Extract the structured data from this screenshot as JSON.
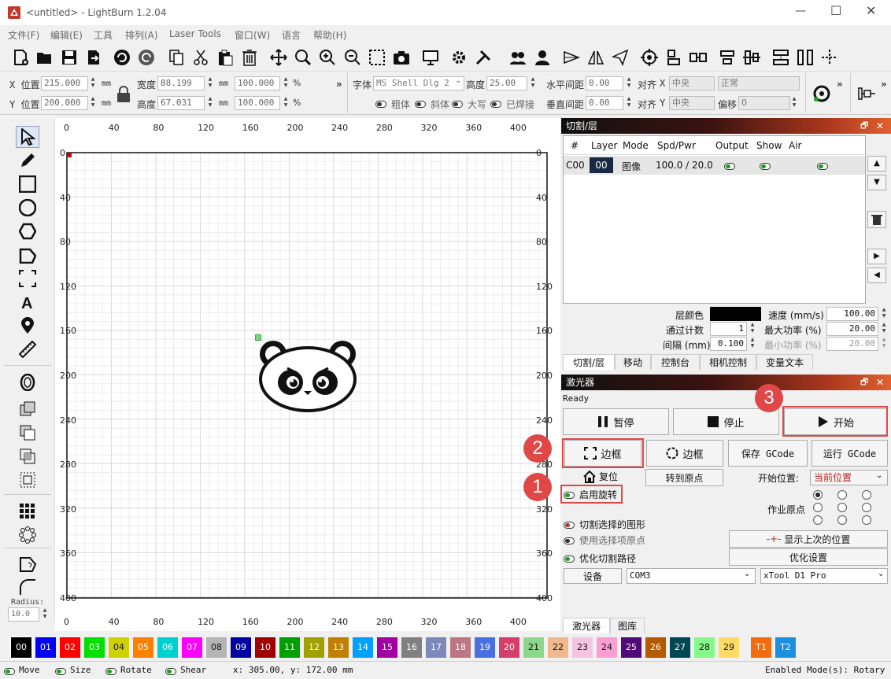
{
  "window": {
    "title": "<untitled> - LightBurn 1.2.04"
  },
  "menu": [
    "文件(F)",
    "编辑(E)",
    "工具",
    "排列(A)",
    "Laser Tools",
    "窗口(W)",
    "语言",
    "帮助(H)"
  ],
  "props": {
    "x_label": "X 位置",
    "x_value": "215.000",
    "y_label": "Y 位置",
    "y_value": "200.000",
    "unit": "mm",
    "width_label": "宽度",
    "width_value": "88.199",
    "height_label": "高度",
    "height_value": "67.031",
    "scale_w": "100.000",
    "scale_h": "100.000",
    "percent": "%",
    "font_label": "字体",
    "font_value": "MS Shell Dlg 2",
    "fheight_label": "高度",
    "fheight_value": "25.00",
    "hspace_label": "水平间距",
    "hspace_value": "0.00",
    "vspace_label": "垂直间距",
    "vspace_value": "0.00",
    "align_label": "对齐",
    "align_x": "X",
    "align_y": "Y",
    "align_x_value": "中央",
    "align_y_value": "中央",
    "normal_value": "正常",
    "offset_label": "偏移",
    "offset_value": "0",
    "bold": "粗体",
    "italic": "斜体",
    "upper": "大写",
    "welded": "已焊接"
  },
  "left_tools": {
    "radius_label": "Radius:",
    "radius_value": "10.0"
  },
  "ruler": {
    "top": [
      "0",
      "40",
      "80",
      "120",
      "160",
      "200",
      "240",
      "280",
      "320",
      "360",
      "400"
    ],
    "left": [
      "0",
      "40",
      "80",
      "120",
      "160",
      "200",
      "240",
      "280",
      "320",
      "360",
      "400"
    ],
    "right": [
      "0",
      "40",
      "80",
      "120",
      "160",
      "200",
      "240",
      "280",
      "320",
      "360",
      "400"
    ]
  },
  "cut_panel": {
    "title": "切割/层",
    "headers": [
      "#",
      "Layer",
      "Mode",
      "Spd/Pwr",
      "Output",
      "Show",
      "Air"
    ],
    "row": {
      "id": "C00",
      "layer": "00",
      "mode": "图像",
      "spdpwr": "100.0 / 20.0"
    },
    "color_label": "层颜色",
    "speed_label": "速度 (mm/s)",
    "speed_value": "100.00",
    "passes_label": "通过计数",
    "passes_value": "1",
    "maxpow_label": "最大功率 (%)",
    "maxpow_value": "20.00",
    "interval_label": "间隔 (mm)",
    "interval_value": "0.100",
    "minpow_label": "最小功率 (%)",
    "minpow_value": "20.00",
    "tabs": [
      "切割/层",
      "移动",
      "控制台",
      "相机控制",
      "变量文本"
    ]
  },
  "laser_panel": {
    "title": "激光器",
    "status": "Ready",
    "pause": "暂停",
    "stop": "停止",
    "start": "开始",
    "frame1": "边框",
    "frame2": "边框",
    "save_gcode": "保存 GCode",
    "run_gcode": "运行 GCode",
    "home": "复位",
    "goto_origin": "转到原点",
    "start_from_label": "开始位置:",
    "start_from_value": "当前位置",
    "rotary": "启用旋转",
    "job_origin_label": "作业原点",
    "cut_selected": "切割选择的图形",
    "use_sel_origin": "使用选择项原点",
    "show_last": "显示上次的位置",
    "optimize_cut": "优化切割路径",
    "opt_settings": "优化设置",
    "devices": "设备",
    "port": "COM3",
    "device_name": "xTool D1 Pro",
    "tabs": [
      "激光器",
      "图库"
    ]
  },
  "callouts": [
    "1",
    "2",
    "3"
  ],
  "palette": [
    {
      "label": "00",
      "color": "#000000"
    },
    {
      "label": "01",
      "color": "#0000ff"
    },
    {
      "label": "02",
      "color": "#ff0000"
    },
    {
      "label": "03",
      "color": "#00e000"
    },
    {
      "label": "04",
      "color": "#d0d000"
    },
    {
      "label": "05",
      "color": "#ff8000"
    },
    {
      "label": "06",
      "color": "#00d0d0"
    },
    {
      "label": "07",
      "color": "#ff00ff"
    },
    {
      "label": "08",
      "color": "#b4b4b4"
    },
    {
      "label": "09",
      "color": "#0000a0"
    },
    {
      "label": "10",
      "color": "#a00000"
    },
    {
      "label": "11",
      "color": "#00a000"
    },
    {
      "label": "12",
      "color": "#a0a000"
    },
    {
      "label": "13",
      "color": "#c08000"
    },
    {
      "label": "14",
      "color": "#00a0ff"
    },
    {
      "label": "15",
      "color": "#a000a0"
    },
    {
      "label": "16",
      "color": "#808080"
    },
    {
      "label": "17",
      "color": "#7d87b9"
    },
    {
      "label": "18",
      "color": "#bb7784"
    },
    {
      "label": "19",
      "color": "#4a6fe3"
    },
    {
      "label": "20",
      "color": "#d33f6a"
    },
    {
      "label": "21",
      "color": "#8cd78c"
    },
    {
      "label": "22",
      "color": "#f0b98d"
    },
    {
      "label": "23",
      "color": "#f6c4e1"
    },
    {
      "label": "24",
      "color": "#fa9ed4"
    },
    {
      "label": "25",
      "color": "#500a78"
    },
    {
      "label": "26",
      "color": "#b45a00"
    },
    {
      "label": "27",
      "color": "#004754"
    },
    {
      "label": "28",
      "color": "#86fa88"
    },
    {
      "label": "29",
      "color": "#ffdb66"
    },
    {
      "label": "T1",
      "color": "#f36b0c"
    },
    {
      "label": "T2",
      "color": "#1d8fe0"
    }
  ],
  "statusbar": {
    "move": "Move",
    "size": "Size",
    "rotate": "Rotate",
    "shear": "Shear",
    "coords": "x: 305.00, y: 172.00 mm",
    "mode": "Enabled Mode(s): Rotary"
  }
}
